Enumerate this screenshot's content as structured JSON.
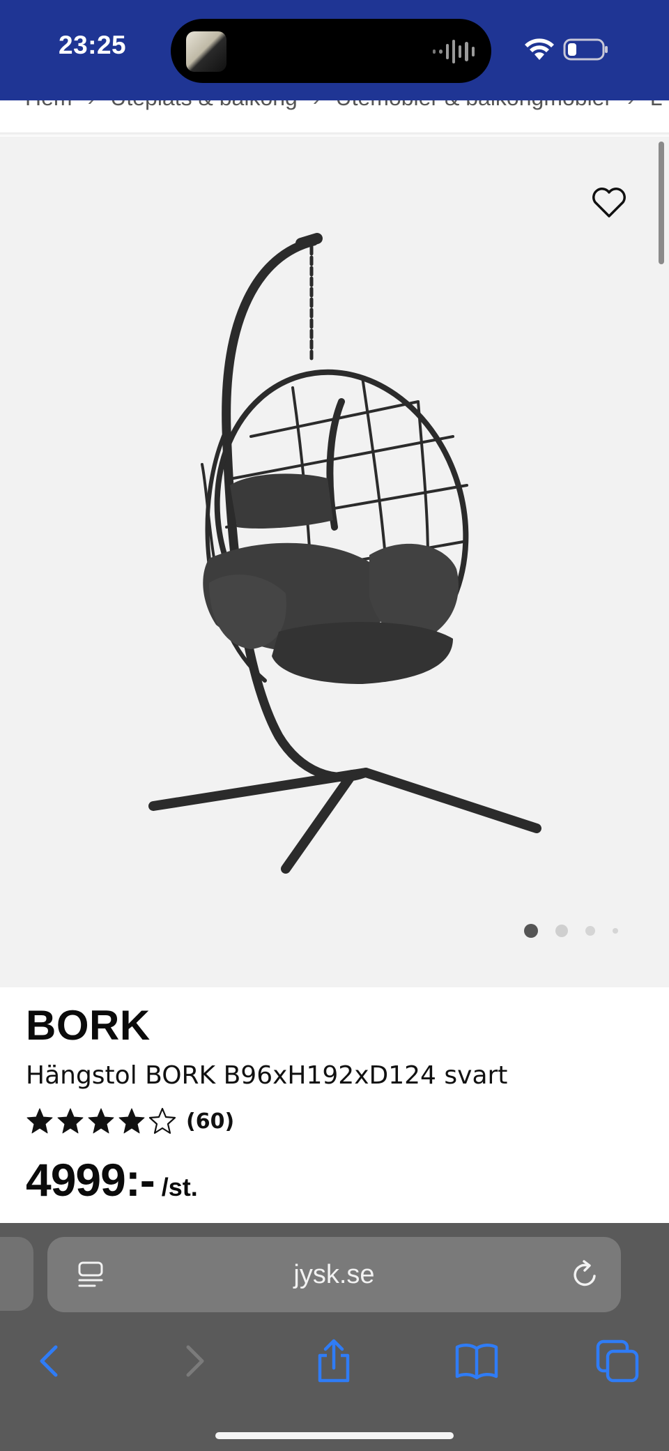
{
  "status_bar": {
    "time": "23:25",
    "icons": [
      "wifi-icon",
      "battery-icon"
    ]
  },
  "breadcrumb": {
    "items": [
      "Hem",
      "Uteplats & balkong",
      "Utemöbler & balkongmöbler",
      "L"
    ],
    "separator": "›"
  },
  "product": {
    "image_alt": "Hängstol BORK",
    "brand": "BORK",
    "name": "Hängstol BORK B96xH192xD124 svart",
    "rating": 4,
    "rating_max": 5,
    "review_count": "(60)",
    "price": "4999:-",
    "price_unit": "/st.",
    "image_count": 4,
    "active_image": 1
  },
  "browser": {
    "url": "jysk.se"
  },
  "colors": {
    "status_bar_bg": "#1f3594",
    "image_bg": "#f2f2f2",
    "browser_bg": "#5a5a5a",
    "toolbar_icon": "#2f7cf6"
  }
}
